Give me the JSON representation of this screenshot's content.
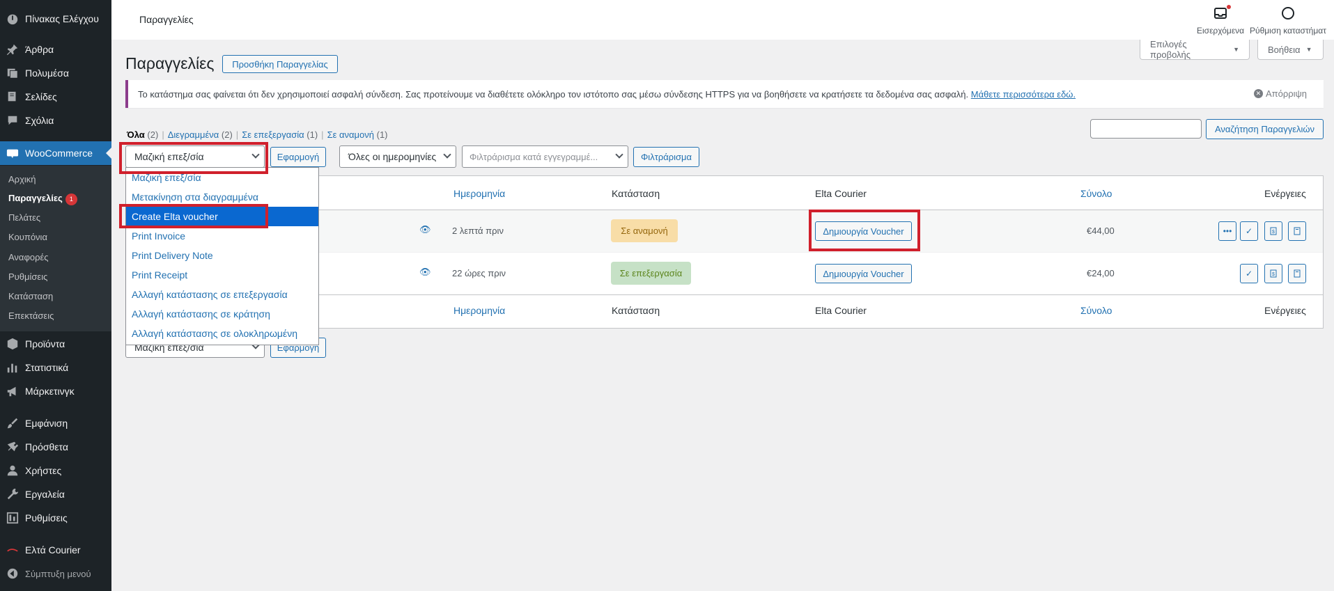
{
  "sidebar": {
    "items": [
      {
        "label": "Πίνακας Ελέγχου",
        "icon": "dashboard-icon"
      },
      {
        "label": "Άρθρα",
        "icon": "pin-icon"
      },
      {
        "label": "Πολυμέσα",
        "icon": "media-icon"
      },
      {
        "label": "Σελίδες",
        "icon": "pages-icon"
      },
      {
        "label": "Σχόλια",
        "icon": "comments-icon"
      },
      {
        "label": "WooCommerce",
        "icon": "woocommerce-icon"
      },
      {
        "label": "Προϊόντα",
        "icon": "products-icon"
      },
      {
        "label": "Στατιστικά",
        "icon": "stats-icon"
      },
      {
        "label": "Μάρκετινγκ",
        "icon": "megaphone-icon"
      },
      {
        "label": "Εμφάνιση",
        "icon": "brush-icon"
      },
      {
        "label": "Πρόσθετα",
        "icon": "plugin-icon"
      },
      {
        "label": "Χρήστες",
        "icon": "users-icon"
      },
      {
        "label": "Εργαλεία",
        "icon": "wrench-icon"
      },
      {
        "label": "Ρυθμίσεις",
        "icon": "settings-icon"
      },
      {
        "label": "Ελτά Courier",
        "icon": "elta-icon"
      },
      {
        "label": "Σύμπτυξη μενού",
        "icon": "collapse-icon"
      }
    ],
    "submenu": [
      {
        "label": "Αρχική"
      },
      {
        "label": "Παραγγελίες",
        "badge": "1"
      },
      {
        "label": "Πελάτες"
      },
      {
        "label": "Κουπόνια"
      },
      {
        "label": "Αναφορές"
      },
      {
        "label": "Ρυθμίσεις"
      },
      {
        "label": "Κατάσταση"
      },
      {
        "label": "Επεκτάσεις"
      }
    ]
  },
  "topbar": {
    "title": "Παραγγελίες",
    "inbox_label": "Εισερχόμενα",
    "setup_label": "Ρύθμιση καταστήματ"
  },
  "screen_meta": {
    "options_label": "Επιλογές προβολής",
    "help_label": "Βοήθεια"
  },
  "page": {
    "title": "Παραγγελίες",
    "add_button": "Προσθήκη Παραγγελίας"
  },
  "notice": {
    "text": "Το κατάστημα σας φαίνεται ότι δεν χρησιμοποιεί ασφαλή σύνδεση. Σας προτείνουμε να διαθέτετε ολόκληρο τον ιστότοπο σας μέσω σύνδεσης HTTPS για να βοηθήσετε να κρατήσετε τα δεδομένα σας ασφαλή.",
    "link": "Μάθετε περισσότερα εδώ.",
    "dismiss": "Απόρριψη"
  },
  "views": [
    {
      "label": "Όλα",
      "count": "(2)"
    },
    {
      "label": "Διεγραμμένα",
      "count": "(2)"
    },
    {
      "label": "Σε επεξεργασία",
      "count": "(1)"
    },
    {
      "label": "Σε αναμονή",
      "count": "(1)"
    }
  ],
  "search": {
    "value": "",
    "button": "Αναζήτηση Παραγγελιών"
  },
  "filters": {
    "bulk_action": "Μαζική επεξ/σία",
    "apply": "Εφαρμογή",
    "dates": "Όλες οι ημερομηνίες",
    "customer_placeholder": "Φιλτράρισμα κατά εγγεγραμμέ...",
    "filter_button": "Φιλτράρισμα"
  },
  "bulk_dropdown": {
    "options": [
      "Μαζική επεξ/σία",
      "Μετακίνηση στα διαγραμμένα",
      "Create Elta voucher",
      "Print Invoice",
      "Print Delivery Note",
      "Print Receipt",
      "Αλλαγή κατάστασης σε επεξεργασία",
      "Αλλαγή κατάστασης σε κράτηση",
      "Αλλαγή κατάστασης σε ολοκληρωμένη"
    ],
    "selected": "Create Elta voucher"
  },
  "table": {
    "columns": {
      "date": "Ημερομηνία",
      "status": "Κατάσταση",
      "courier": "Elta Courier",
      "total": "Σύνολο",
      "actions": "Ενέργειες"
    },
    "rows": [
      {
        "date": "2 λεπτά πριν",
        "status": "Σε αναμονή",
        "voucher": "Δημιουργία Voucher",
        "total": "€44,00"
      },
      {
        "date": "22 ώρες πριν",
        "status": "Σε επεξεργασία",
        "voucher": "Δημιουργία Voucher",
        "total": "€24,00"
      }
    ]
  },
  "bottom_filters": {
    "bulk_action": "Μαζική επεξ/σία",
    "apply": "Εφαρμογή"
  },
  "colors": {
    "accent": "#2271b1",
    "sidebar": "#1d2327",
    "highlight": "#d0202c",
    "on_hold": "#f8dda7",
    "processing": "#c6e1c6"
  }
}
